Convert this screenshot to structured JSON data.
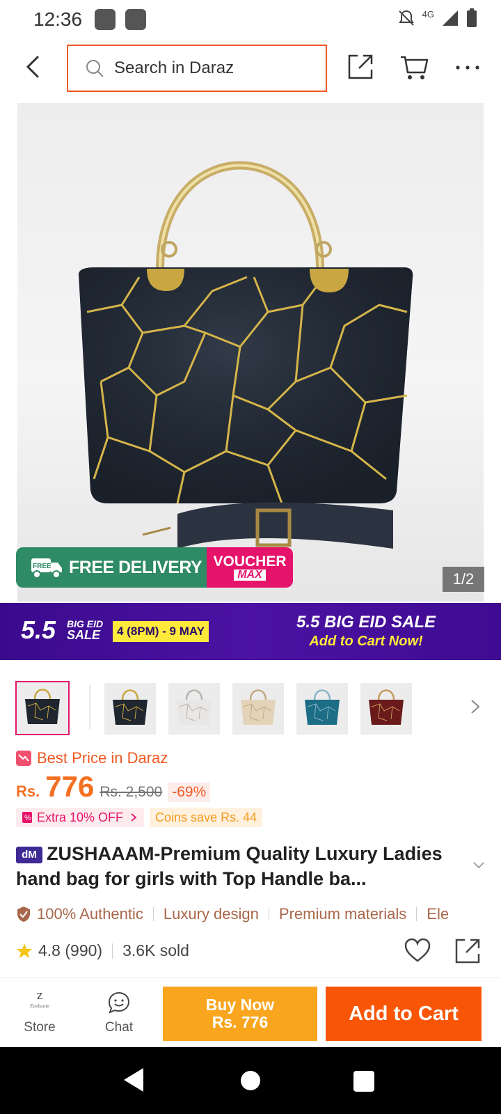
{
  "status_bar": {
    "time": "12:36",
    "network": "4G"
  },
  "search": {
    "placeholder": "Search in Daraz"
  },
  "product": {
    "image_counter": "1/2",
    "badge_free_delivery": "FREE DELIVERY",
    "badge_free_small": "FREE",
    "badge_voucher": "VOUCHER",
    "badge_voucher_max": "MAX",
    "best_price_label": "Best Price in Daraz",
    "currency": "Rs.",
    "price": "776",
    "old_price": "Rs. 2,500",
    "discount": "-69%",
    "extra_off": "Extra 10% OFF",
    "coins_save": "Coins save Rs. 44",
    "brand_badge": "dM",
    "title": "ZUSHAAAM-Premium Quality Luxury Ladies hand bag for girls with Top Handle ba...",
    "features": [
      "100% Authentic",
      "Luxury design",
      "Premium materials",
      "Ele"
    ],
    "rating": "4.8 (990)",
    "sold": "3.6K sold"
  },
  "eid_banner": {
    "big_number": "5.5",
    "small_line1": "BIG EID",
    "small_line2": "SALE",
    "date_range": "4 (8PM) - 9 MAY",
    "title": "5.5 BIG EID SALE",
    "cta": "Add to Cart Now!"
  },
  "thumbnails": [
    {
      "color": "#1f2630",
      "accent": "#c9a642"
    },
    {
      "color": "#1f2630",
      "accent": "#c9a642"
    },
    {
      "color": "#e9e7e6",
      "accent": "#b8b3ad"
    },
    {
      "color": "#e3d3b8",
      "accent": "#c2aa80"
    },
    {
      "color": "#1d6d86",
      "accent": "#88b6c4"
    },
    {
      "color": "#6b1a1c",
      "accent": "#c49a5a"
    }
  ],
  "bottom_bar": {
    "store_label": "Store",
    "store_logo_text": "Zushaam",
    "chat_label": "Chat",
    "buy_now_line1": "Buy Now",
    "buy_now_line2": "Rs. 776",
    "add_to_cart": "Add to Cart"
  },
  "colors": {
    "accent_orange": "#f85606",
    "buy_now_yellow": "#f9a51e",
    "banner_purple": "#3b0a8c",
    "delivery_green": "#2f8a66",
    "voucher_pink": "#e6136b"
  }
}
